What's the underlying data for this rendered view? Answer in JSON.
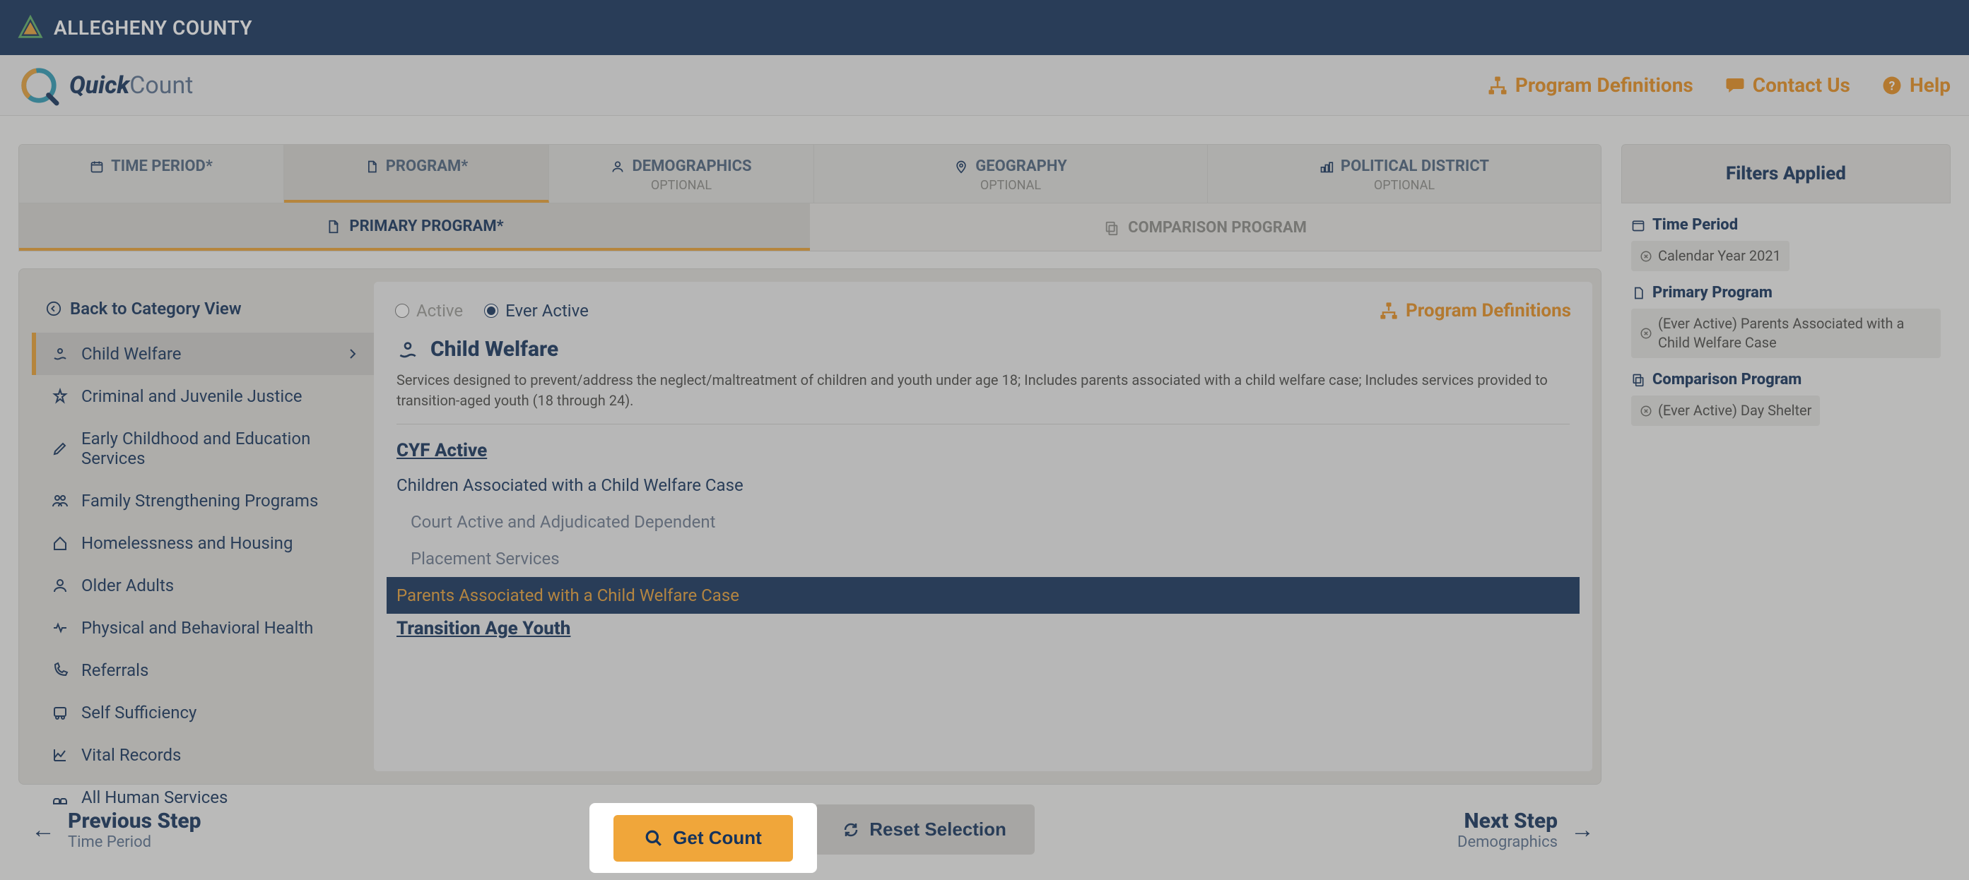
{
  "topbar": {
    "county_name": "ALLEGHENY COUNTY"
  },
  "brand": {
    "bold": "Quick",
    "light": "Count"
  },
  "header_links": {
    "program_definitions": "Program Definitions",
    "contact_us": "Contact Us",
    "help": "Help"
  },
  "steps": {
    "time_period": "TIME PERIOD*",
    "program": "PROGRAM*",
    "demographics": "DEMOGRAPHICS",
    "demographics_sub": "OPTIONAL",
    "geography": "GEOGRAPHY",
    "geography_sub": "OPTIONAL",
    "political": "POLITICAL DISTRICT",
    "political_sub": "OPTIONAL"
  },
  "subtabs": {
    "primary": "PRIMARY PROGRAM*",
    "comparison": "COMPARISON PROGRAM"
  },
  "sidebar": {
    "back": "Back to Category View",
    "items": {
      "child_welfare": "Child Welfare",
      "cjj": "Criminal and Juvenile Justice",
      "ece": "Early Childhood and Education Services",
      "fsp": "Family Strengthening Programs",
      "hh": "Homelessness and Housing",
      "older": "Older Adults",
      "pbh": "Physical and Behavioral Health",
      "referrals": "Referrals",
      "self": "Self Sufficiency",
      "vital": "Vital Records",
      "ahs": "All Human Services"
    }
  },
  "radios": {
    "active": "Active",
    "ever_active": "Ever Active"
  },
  "pd_link": "Program Definitions",
  "detail": {
    "title": "Child Welfare",
    "desc": "Services designed to prevent/address the neglect/maltreatment of children and youth under age 18; Includes parents associated with a child welfare case; Includes services provided to transition-aged youth (18 through 24).",
    "group1": "CYF Active",
    "i1": "Children Associated with a Child Welfare Case",
    "i2": "Court Active and Adjudicated Dependent",
    "i3": "Placement Services",
    "i4": "Parents Associated with a Child Welfare Case",
    "group2": "Transition Age Youth"
  },
  "footer": {
    "prev_major": "Previous Step",
    "prev_minor": "Time Period",
    "get_count": "Get Count",
    "reset": "Reset Selection",
    "next_major": "Next Step",
    "next_minor": "Demographics"
  },
  "filters": {
    "panel_title": "Filters Applied",
    "g1_title": "Time Period",
    "g1_chip": "Calendar Year 2021",
    "g2_title": "Primary Program",
    "g2_chip": "(Ever Active) Parents Associated with a Child Welfare Case",
    "g3_title": "Comparison Program",
    "g3_chip": "(Ever Active) Day Shelter"
  }
}
